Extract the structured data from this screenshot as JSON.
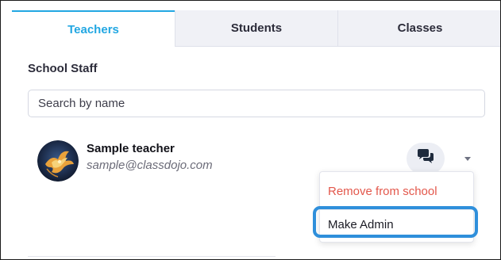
{
  "tabs": [
    {
      "label": "Teachers",
      "active": true
    },
    {
      "label": "Students",
      "active": false
    },
    {
      "label": "Classes",
      "active": false
    }
  ],
  "section_title": "School Staff",
  "search": {
    "placeholder": "Search by name",
    "value": ""
  },
  "staff": {
    "name": "Sample teacher",
    "email": "sample@classdojo.com",
    "avatar_icon": "phoenix-avatar-icon",
    "message_icon": "chat-bubbles-icon",
    "caret_icon": "caret-down-icon"
  },
  "menu": {
    "remove_label": "Remove from school",
    "make_admin_label": "Make Admin"
  },
  "colors": {
    "accent": "#22a7e2",
    "danger": "#e3574b",
    "highlight": "#2f8fdb"
  }
}
